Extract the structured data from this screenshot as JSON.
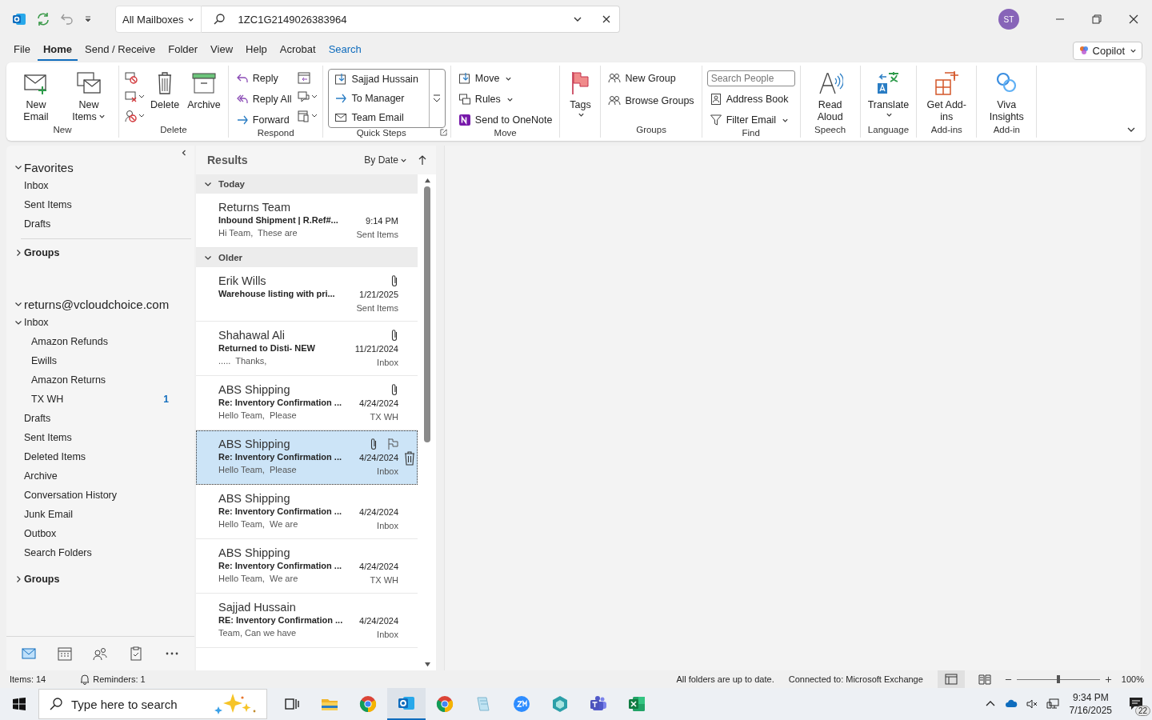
{
  "title_bar": {
    "scope": "All Mailboxes",
    "search_value": "1ZC1G2149026383964",
    "avatar": "ST"
  },
  "menu_tabs": [
    {
      "label": "File",
      "kind": "normal",
      "selected": false
    },
    {
      "label": "Home",
      "kind": "normal",
      "selected": true
    },
    {
      "label": "Send / Receive",
      "kind": "normal",
      "selected": false
    },
    {
      "label": "Folder",
      "kind": "normal",
      "selected": false
    },
    {
      "label": "View",
      "kind": "normal",
      "selected": false
    },
    {
      "label": "Help",
      "kind": "normal",
      "selected": false
    },
    {
      "label": "Acrobat",
      "kind": "normal",
      "selected": false
    },
    {
      "label": "Search",
      "kind": "contextual",
      "selected": false
    }
  ],
  "copilot": "Copilot",
  "ribbon": {
    "groups": [
      {
        "label": "New",
        "items": [
          {
            "label": "New Email"
          },
          {
            "label": "New Items"
          }
        ]
      },
      {
        "label": "Delete",
        "items": [
          {
            "label": "Delete"
          },
          {
            "label": "Archive"
          }
        ]
      },
      {
        "label": "Respond",
        "items": [
          {
            "label": "Reply"
          },
          {
            "label": "Reply All"
          },
          {
            "label": "Forward"
          }
        ]
      },
      {
        "label": "Quick Steps",
        "items": [
          {
            "label": "Sajjad Hussain"
          },
          {
            "label": "To Manager"
          },
          {
            "label": "Team Email"
          }
        ]
      },
      {
        "label": "Move",
        "items": [
          {
            "label": "Move"
          },
          {
            "label": "Rules"
          },
          {
            "label": "Send to OneNote"
          }
        ]
      },
      {
        "items": [
          {
            "label": "Tags"
          }
        ]
      },
      {
        "label": "Groups",
        "items": [
          {
            "label": "New Group"
          },
          {
            "label": "Browse Groups"
          }
        ]
      },
      {
        "label": "Find",
        "placeholder": "Search People",
        "items": [
          {
            "label": "Address Book"
          },
          {
            "label": "Filter Email"
          }
        ]
      },
      {
        "label": "Speech",
        "items": [
          {
            "label": "Read Aloud"
          }
        ]
      },
      {
        "label": "Language",
        "items": [
          {
            "label": "Translate"
          }
        ]
      },
      {
        "label": "Add-ins",
        "items": [
          {
            "label": "Get Add-ins"
          }
        ]
      },
      {
        "label": "Add-in",
        "items": [
          {
            "label": "Viva Insights"
          }
        ]
      }
    ]
  },
  "folder_pane": {
    "favorites": {
      "title": "Favorites",
      "expanded": true,
      "items": [
        {
          "name": "Inbox"
        },
        {
          "name": "Sent Items"
        },
        {
          "name": "Drafts"
        }
      ]
    },
    "favorite_groups": {
      "title": "Groups",
      "expanded": false
    },
    "account": {
      "title": "returns@vcloudchoice.com",
      "expanded": true,
      "folders": [
        {
          "name": "Inbox",
          "expanded": true,
          "children": [
            {
              "name": "Amazon Refunds"
            },
            {
              "name": "Ewills"
            },
            {
              "name": "Amazon Returns"
            },
            {
              "name": "TX WH",
              "count": "1"
            }
          ]
        },
        {
          "name": "Drafts"
        },
        {
          "name": "Sent Items"
        },
        {
          "name": "Deleted Items"
        },
        {
          "name": "Archive"
        },
        {
          "name": "Conversation History"
        },
        {
          "name": "Junk Email"
        },
        {
          "name": "Outbox"
        },
        {
          "name": "Search Folders"
        }
      ]
    },
    "account_groups": {
      "title": "Groups",
      "expanded": false
    },
    "nav_items": [
      {
        "kind": "mail",
        "selected": true
      },
      {
        "kind": "calendar",
        "selected": false
      },
      {
        "kind": "people",
        "selected": false
      },
      {
        "kind": "tasks",
        "selected": false
      },
      {
        "kind": "more",
        "selected": false
      }
    ]
  },
  "message_list": {
    "title": "Results",
    "sort": "By Date",
    "groups": [
      {
        "label": "Today",
        "expanded": true,
        "messages": [
          {
            "sender": "Returns Team",
            "subject": "Inbound Shipment | R.Ref#...",
            "preview": "Hi Team,  These are",
            "date": "9:14 PM",
            "folder": "Sent Items",
            "attachment": false,
            "selected": false
          }
        ]
      },
      {
        "label": "Older",
        "expanded": true,
        "messages": [
          {
            "sender": "Erik Wills",
            "subject": "Warehouse listing with pri...",
            "date": "1/21/2025",
            "folder": "Sent Items",
            "attachment": true,
            "selected": false
          },
          {
            "sender": "Shahawal Ali",
            "subject": "Returned to Disti- NEW",
            "preview": ".....  Thanks,",
            "date": "11/21/2024",
            "folder": "Inbox",
            "attachment": true,
            "selected": false
          },
          {
            "sender": "ABS Shipping",
            "subject": "Re: Inventory Confirmation ...",
            "preview": "Hello Team,  Please",
            "date": "4/24/2024",
            "folder": "TX WH",
            "attachment": true,
            "selected": false
          },
          {
            "sender": "ABS Shipping",
            "subject": "Re: Inventory Confirmation ...",
            "preview": "Hello Team,  Please",
            "date": "4/24/2024",
            "folder": "Inbox",
            "attachment": true,
            "selected": true
          },
          {
            "sender": "ABS Shipping",
            "subject": "Re: Inventory Confirmation ...",
            "preview": "Hello Team,  We are",
            "date": "4/24/2024",
            "folder": "Inbox",
            "attachment": false,
            "selected": false
          },
          {
            "sender": "ABS Shipping",
            "subject": "Re: Inventory Confirmation ...",
            "preview": "Hello Team,  We are",
            "date": "4/24/2024",
            "folder": "TX WH",
            "attachment": false,
            "selected": false
          },
          {
            "sender": "Sajjad Hussain",
            "subject": "RE: Inventory Confirmation ...",
            "preview": "Team, Can we have",
            "date": "4/24/2024",
            "folder": "Inbox",
            "attachment": false,
            "selected": false
          }
        ]
      }
    ]
  },
  "status_bar": {
    "items": "Items: 14",
    "reminders": "Reminders: 1",
    "sync": "All folders are up to date.",
    "connection": "Connected to: Microsoft Exchange",
    "zoom_slider": {
      "level": 0.5
    },
    "zoom": "100%"
  },
  "taskbar": {
    "search_placeholder": "Type here to search",
    "apps": [
      {
        "kind": "taskview",
        "selected": false
      },
      {
        "kind": "explorer",
        "selected": false
      },
      {
        "kind": "chrome",
        "selected": false
      },
      {
        "kind": "outlook",
        "selected": true
      },
      {
        "kind": "chrome",
        "selected": false
      },
      {
        "kind": "notepad",
        "selected": false
      },
      {
        "kind": "zoom",
        "selected": false
      },
      {
        "kind": "app",
        "selected": false
      },
      {
        "kind": "teams",
        "selected": false
      },
      {
        "kind": "excel",
        "selected": false
      }
    ],
    "time": "9:34 PM",
    "date": "7/16/2025",
    "notifications": "22"
  }
}
